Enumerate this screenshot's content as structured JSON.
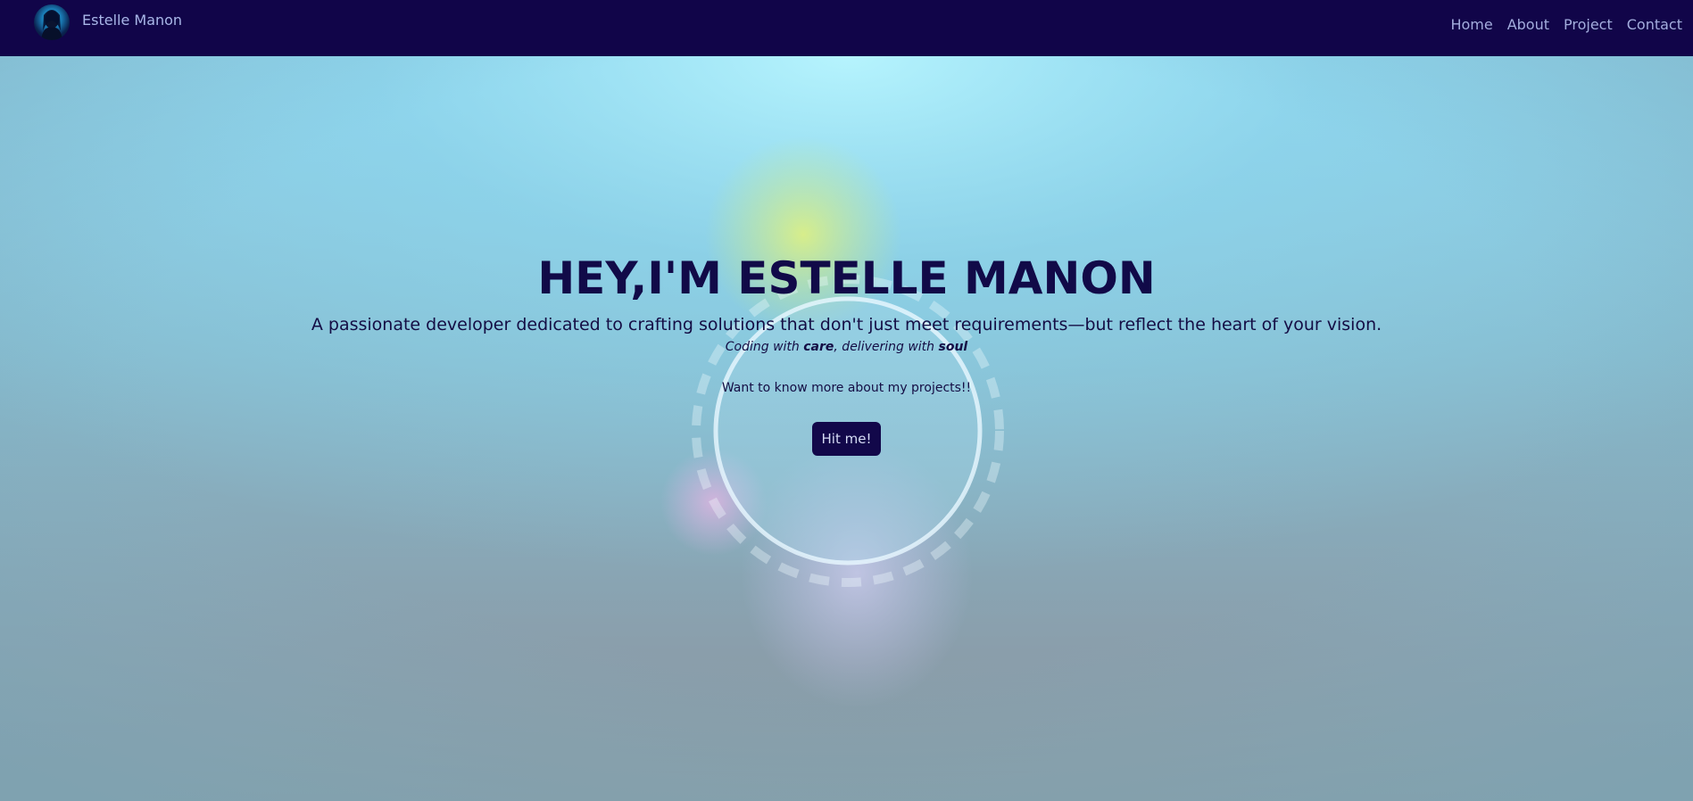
{
  "nav": {
    "brand_name": "Estelle Manon",
    "links": [
      "Home",
      "About",
      "Project",
      "Contact"
    ]
  },
  "hero": {
    "title": "HEY,I'M ESTELLE MANON",
    "subtitle": "A passionate developer dedicated to crafting solutions that don't just meet requirements—but reflect the heart of your vision.",
    "tagline": {
      "prefix": "Coding with ",
      "word1": "care",
      "middle": ", delivering with ",
      "word2": "soul"
    },
    "prompt": "Want to know more about my projects!!",
    "button_label": "Hit me!"
  },
  "colors": {
    "navbar_bg": "#110549",
    "nav_text": "#a3addd",
    "heading_text": "#110a48",
    "button_bg": "#12084a"
  }
}
